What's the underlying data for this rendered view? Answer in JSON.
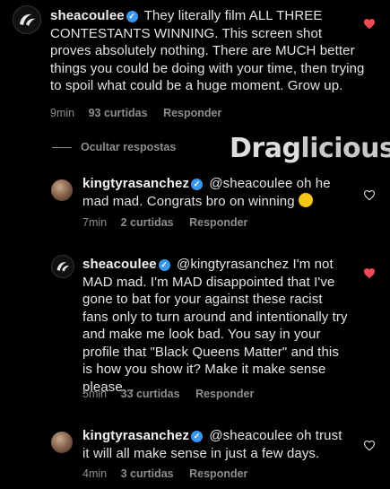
{
  "watermark": {
    "part1": "Drag",
    "part2": "licious"
  },
  "comments": [
    {
      "username": "sheacoulee",
      "text": "They literally film ALL THREE CONTESTANTS WINNING. This screen shot proves absolutely nothing. There are MUCH better things you could be doing with your time, then trying to spoil what could be a huge moment. Grow up.",
      "time": "9min",
      "likes": "93 curtidas",
      "reply_label": "Responder",
      "liked": true
    },
    {
      "username": "kingtyrasanchez",
      "text": "@sheacoulee oh he mad mad. Congrats bro on winning",
      "emoji": "grimacing-face",
      "time": "7min",
      "likes": "2 curtidas",
      "reply_label": "Responder",
      "liked": false
    },
    {
      "username": "sheacoulee",
      "text": "@kingtyrasanchez I'm not MAD mad. I'm MAD disappointed that I've gone to bat for your against these racist fans only to turn around and intentionally try and make me look bad. You say in your profile that \"Black Queens Matter\" and this is how you show it? Make it make sense please...",
      "time": "5min",
      "likes": "33 curtidas",
      "reply_label": "Responder",
      "liked": true
    },
    {
      "username": "kingtyrasanchez",
      "text": "@sheacoulee oh trust it will all make sense in just a few days.",
      "time": "4min",
      "likes": "3 curtidas",
      "reply_label": "Responder",
      "liked": false
    }
  ],
  "hide_replies_label": "Ocultar respostas",
  "colors": {
    "heart_liked": "#ed4956",
    "verified": "#3897f0",
    "meta": "#8e8e8e"
  }
}
